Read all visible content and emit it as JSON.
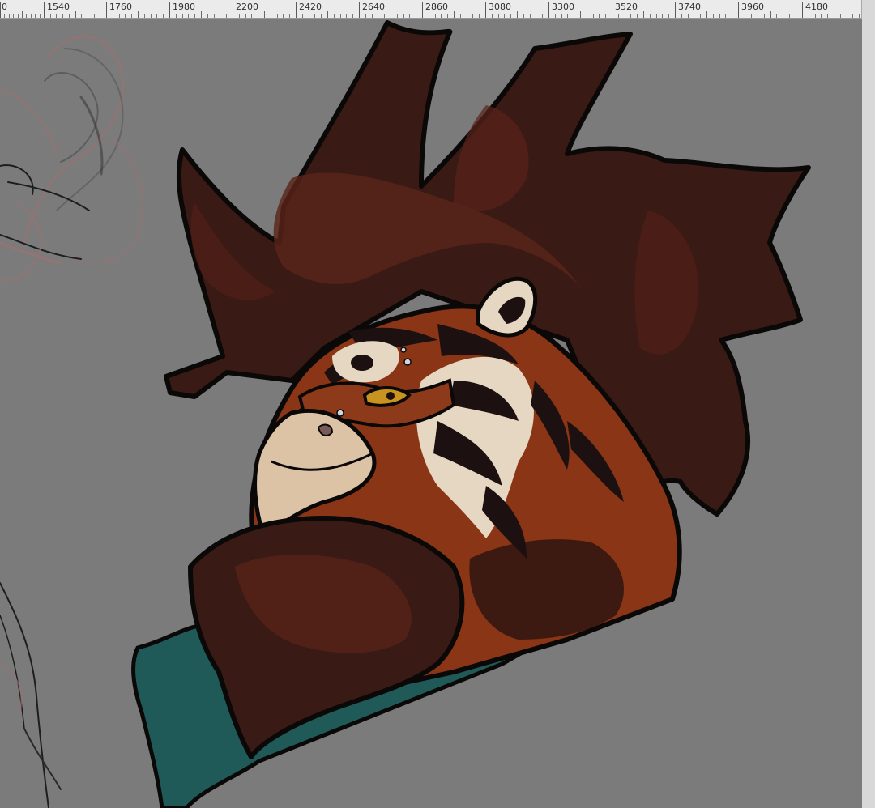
{
  "app": {
    "background_color": "#7b7b7b"
  },
  "ruler": {
    "orientation": "horizontal",
    "labels": [
      "0",
      "1540",
      "1760",
      "1980",
      "2200",
      "2420",
      "2640",
      "2860",
      "3080",
      "3300",
      "3520",
      "3740",
      "3960",
      "4180"
    ]
  },
  "artwork": {
    "subject": "rooster with tiger-stripe markings",
    "palette": {
      "comb": "#3a1a14",
      "comb_shade": "#4f1f17",
      "feather_orange": "#8a3516",
      "stripe_dark": "#1c1010",
      "cream": "#e6d7c3",
      "beak": "#dcc3a6",
      "eye": "#c9931f",
      "mask": "#8c3a1a",
      "teal": "#1f5a58",
      "line": "#0b0808",
      "sketch_dark": "#2a2a2a",
      "sketch_red": "#a26f6f"
    }
  },
  "scrollbar": {
    "orientation": "vertical"
  }
}
